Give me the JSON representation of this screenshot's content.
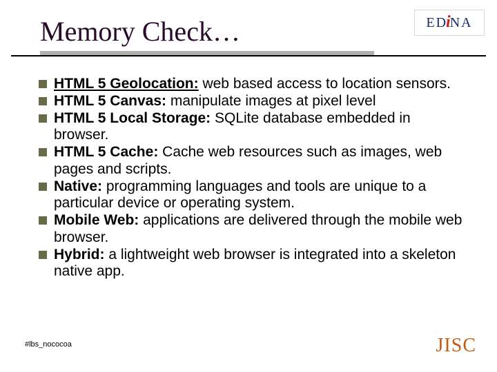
{
  "title": "Memory Check…",
  "logos": {
    "edina_prefix": "ED",
    "edina_i": "i",
    "edina_suffix": "NA",
    "jisc": "JISC"
  },
  "bullets": [
    {
      "term": "HTML 5 Geolocation:",
      "underline": true,
      "desc": " web based access to location sensors."
    },
    {
      "term": "HTML 5  Canvas:",
      "underline": false,
      "desc": " manipulate images at pixel level"
    },
    {
      "term": "HTML 5 Local Storage:",
      "underline": false,
      "desc": " SQLite database embedded in browser."
    },
    {
      "term": "HTML 5 Cache:",
      "underline": false,
      "desc": " Cache web resources such as images, web pages and scripts."
    },
    {
      "term": "Native:",
      "underline": false,
      "desc": " programming languages and tools are unique to a particular device or operating system."
    },
    {
      "term": "Mobile Web:",
      "underline": false,
      "desc": " applications are delivered through the mobile web browser."
    },
    {
      "term": "Hybrid:",
      "underline": false,
      "desc": " a lightweight web browser is integrated into a skeleton native app."
    }
  ],
  "hashtag": "#lbs_nococoa"
}
